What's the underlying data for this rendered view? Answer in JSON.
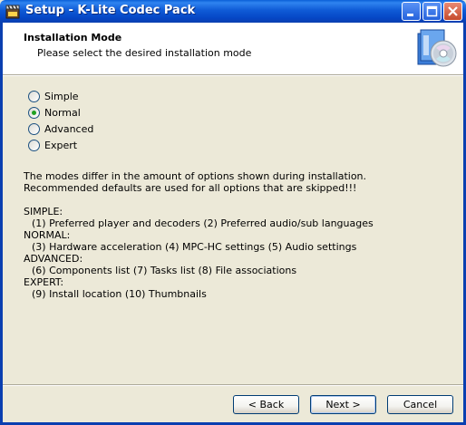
{
  "window": {
    "title": "Setup - K-Lite Codec Pack",
    "app_icon": "film-clapper-icon",
    "controls": [
      "minimize-icon",
      "maximize-icon",
      "close-icon"
    ]
  },
  "header": {
    "title": "Installation Mode",
    "subtitle": "Please select the desired installation mode",
    "icon": "setup-cd-icon"
  },
  "modes": {
    "selected": "Normal",
    "options": [
      {
        "label": "Simple",
        "checked": false
      },
      {
        "label": "Normal",
        "checked": true
      },
      {
        "label": "Advanced",
        "checked": false
      },
      {
        "label": "Expert",
        "checked": false
      }
    ]
  },
  "description": {
    "line1": "The modes differ in the amount of options shown during installation.",
    "line2": "Recommended defaults are used for all options that are skipped!!!"
  },
  "details": {
    "simple_heading": "SIMPLE:",
    "simple_items": "(1) Preferred player and decoders  (2) Preferred audio/sub languages",
    "normal_heading": "NORMAL:",
    "normal_items": "(3) Hardware acceleration  (4) MPC-HC settings  (5) Audio settings",
    "advanced_heading": "ADVANCED:",
    "advanced_items": "(6) Components list  (7) Tasks list  (8) File associations",
    "expert_heading": "EXPERT:",
    "expert_items": "(9) Install location  (10) Thumbnails"
  },
  "buttons": {
    "back": "< Back",
    "next": "Next >",
    "cancel": "Cancel"
  },
  "colors": {
    "titlebar": "#0546c5",
    "dialog_bg": "#ece9d8",
    "radio_checked": "#21a121"
  }
}
